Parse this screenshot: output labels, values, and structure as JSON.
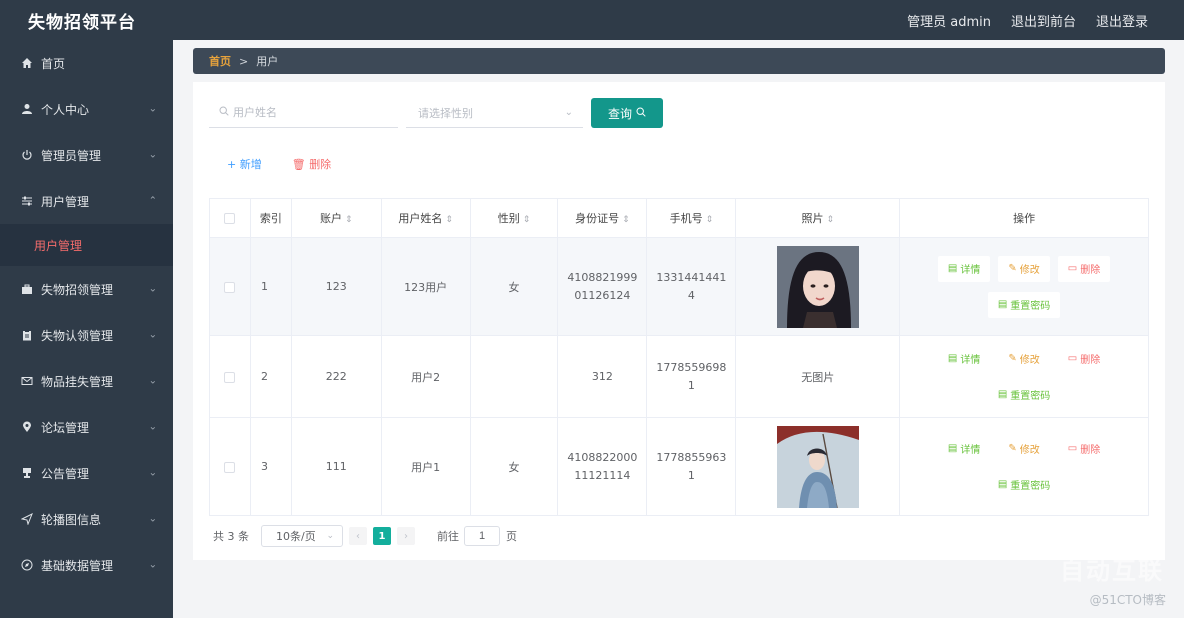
{
  "app": {
    "title": "失物招领平台"
  },
  "header": {
    "user": "管理员 admin",
    "front": "退出到前台",
    "logout": "退出登录"
  },
  "sidebar": {
    "items": [
      {
        "label": "首页",
        "icon": "home-icon",
        "has_children": false
      },
      {
        "label": "个人中心",
        "icon": "user-icon",
        "has_children": true
      },
      {
        "label": "管理员管理",
        "icon": "power-icon",
        "has_children": true
      },
      {
        "label": "用户管理",
        "icon": "sliders-icon",
        "has_children": true,
        "expanded": true
      },
      {
        "label": "失物招领管理",
        "icon": "briefcase-icon",
        "has_children": true
      },
      {
        "label": "失物认领管理",
        "icon": "clipboard-icon",
        "has_children": true
      },
      {
        "label": "物品挂失管理",
        "icon": "mail-icon",
        "has_children": true
      },
      {
        "label": "论坛管理",
        "icon": "location-icon",
        "has_children": true
      },
      {
        "label": "公告管理",
        "icon": "trophy-icon",
        "has_children": true
      },
      {
        "label": "轮播图信息",
        "icon": "send-icon",
        "has_children": true
      },
      {
        "label": "基础数据管理",
        "icon": "compass-icon",
        "has_children": true
      }
    ],
    "active_sub": "用户管理"
  },
  "breadcrumb": {
    "home": "首页",
    "sep": ">",
    "current": "用户"
  },
  "search": {
    "name_placeholder": "用户姓名",
    "gender_placeholder": "请选择性别",
    "query_label": "查询"
  },
  "actions": {
    "add": "新增",
    "delete": "删除"
  },
  "table": {
    "headers": [
      "索引",
      "账户",
      "用户姓名",
      "性别",
      "身份证号",
      "手机号",
      "照片",
      "操作"
    ],
    "rows": [
      {
        "index": "1",
        "account": "123",
        "name": "123用户",
        "gender": "女",
        "id_card_1": "4108821999",
        "id_card_2": "01126124",
        "phone_1": "1331441441",
        "phone_2": "4",
        "photo": "image"
      },
      {
        "index": "2",
        "account": "222",
        "name": "用户2",
        "gender": "",
        "id_card_1": "312",
        "id_card_2": "",
        "phone_1": "1778559698",
        "phone_2": "1",
        "photo": "无图片"
      },
      {
        "index": "3",
        "account": "111",
        "name": "用户1",
        "gender": "女",
        "id_card_1": "4108822000",
        "id_card_2": "11121114",
        "phone_1": "1778855963",
        "phone_2": "1",
        "photo": "image"
      }
    ],
    "ops": {
      "detail": "详情",
      "edit": "修改",
      "delete": "删除",
      "reset": "重置密码"
    }
  },
  "pagination": {
    "total": "共 3 条",
    "page_size": "10条/页",
    "current": "1",
    "goto": "前往",
    "goto_value": "1",
    "page": "页"
  },
  "watermark": {
    "text": "@51CTO博客",
    "logo": "自动互联"
  },
  "colors": {
    "sidebar": "#2f3b48",
    "accent": "#13978b",
    "active": "#f56c6c",
    "breadcrumb": "#3d4957"
  }
}
